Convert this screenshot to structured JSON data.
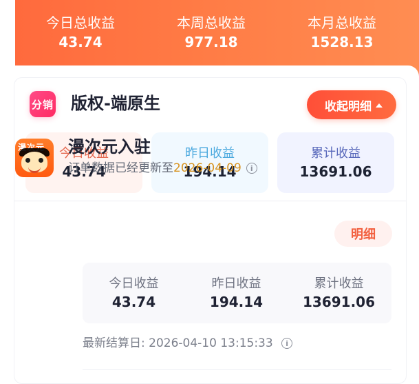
{
  "top_summary": [
    {
      "label": "今日总收益",
      "value": "43.74"
    },
    {
      "label": "本周总收益",
      "value": "977.18"
    },
    {
      "label": "本月总收益",
      "value": "1528.13"
    }
  ],
  "copyright_card": {
    "badge_text": "分销",
    "title": "版权-端原生",
    "collapse_label": "收起明细",
    "stats": [
      {
        "label": "今日收益",
        "value": "43.74"
      },
      {
        "label": "昨日收益",
        "value": "194.14"
      },
      {
        "label": "累计收益",
        "value": "13691.06"
      }
    ]
  },
  "app_section": {
    "icon_text": "漫次元",
    "title": "漫次元入驻",
    "subtitle_prefix": "订单数据已经更新至",
    "subtitle_date": "2026-04-09",
    "detail_label": "明细",
    "stats": [
      {
        "label": "今日收益",
        "value": "43.74"
      },
      {
        "label": "昨日收益",
        "value": "194.14"
      },
      {
        "label": "累计收益",
        "value": "13691.06"
      }
    ],
    "settlement_label": "最新结算日:",
    "settlement_value": "2026-04-10 13:15:33"
  },
  "icons": {
    "info": "info-icon",
    "collapse": "chevron-up-icon"
  },
  "colors": {
    "hero_start": "#ff6a3d",
    "hero_end": "#ff8d52",
    "accent": "#ff5a38",
    "today_text": "#e56950",
    "yesterday_text": "#49a8de",
    "total_text": "#5767ba",
    "date_text": "#d8931f"
  }
}
